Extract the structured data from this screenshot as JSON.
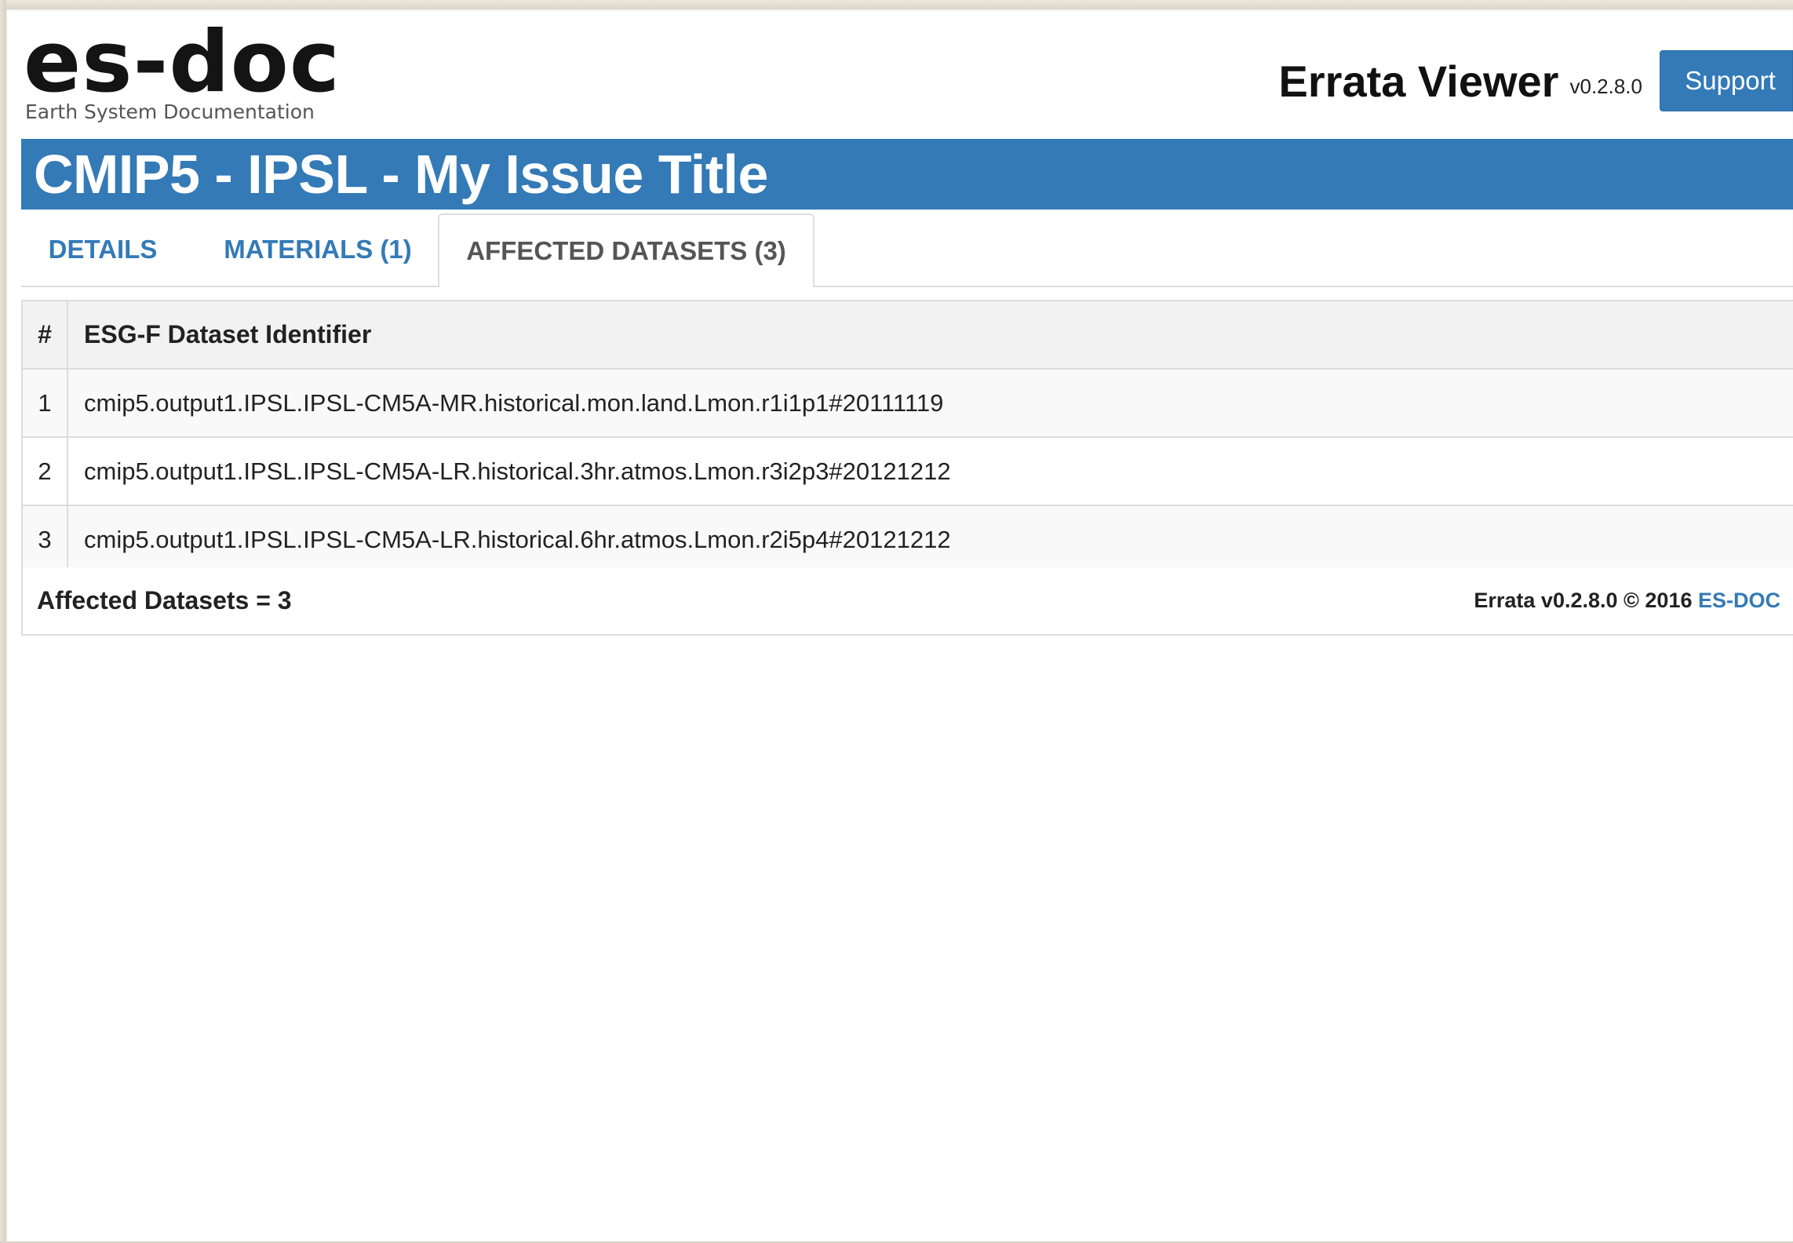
{
  "header": {
    "logo_text": "es-doc",
    "logo_subtitle": "Earth System Documentation",
    "app_title": "Errata Viewer",
    "app_version": "v0.2.8.0",
    "support_label": "Support"
  },
  "issue": {
    "title": "CMIP5 - IPSL - My Issue Title"
  },
  "tabs": [
    {
      "label": "DETAILS",
      "active": false
    },
    {
      "label": "MATERIALS (1)",
      "active": false
    },
    {
      "label": "AFFECTED DATASETS (3)",
      "active": true
    }
  ],
  "table": {
    "headers": [
      "#",
      "ESG-F Dataset Identifier"
    ],
    "rows": [
      {
        "num": "1",
        "id": "cmip5.output1.IPSL.IPSL-CM5A-MR.historical.mon.land.Lmon.r1i1p1#20111119"
      },
      {
        "num": "2",
        "id": "cmip5.output1.IPSL.IPSL-CM5A-LR.historical.3hr.atmos.Lmon.r3i2p3#20121212"
      },
      {
        "num": "3",
        "id": "cmip5.output1.IPSL.IPSL-CM5A-LR.historical.6hr.atmos.Lmon.r2i5p4#20121212"
      }
    ]
  },
  "footer": {
    "count_label": "Affected Datasets = 3",
    "copyright_text": "Errata v0.2.8.0 © 2016 ",
    "link_label": "ES-DOC"
  },
  "colors": {
    "accent": "#337ab7",
    "border": "#dddddd",
    "header_bg": "#f2f2f2"
  }
}
